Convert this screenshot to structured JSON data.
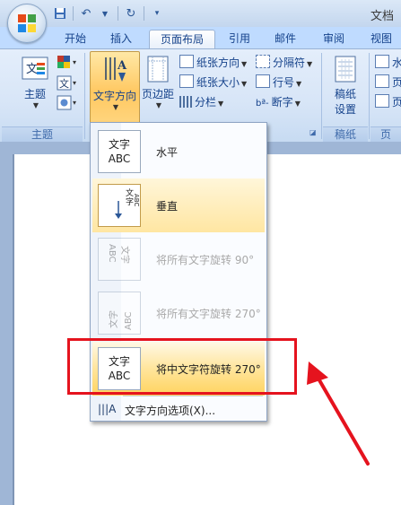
{
  "titlebar": {
    "app_title": "文档",
    "qat_icons": [
      "save-icon",
      "undo-icon",
      "redo-icon",
      "customize-icon"
    ]
  },
  "tabs": [
    "开始",
    "插入",
    "页面布局",
    "引用",
    "邮件",
    "审阅",
    "视图"
  ],
  "active_tab": "页面布局",
  "ribbon": {
    "theme_group": {
      "themes_label": "主题",
      "group_label": "主题"
    },
    "page_setup": {
      "text_direction_label": "文字方向",
      "margins_label": "页边距",
      "orientation_label": "纸张方向",
      "size_label": "纸张大小",
      "columns_label": "分栏",
      "breaks_label": "分隔符",
      "line_numbers_label": "行号",
      "hyphenation_label": "断字"
    },
    "draft_group": {
      "draft_label_line1": "稿纸",
      "draft_label_line2": "设置",
      "group_label": "稿纸"
    },
    "right_group": {
      "item1": "水",
      "item2": "页",
      "item3": "页",
      "group_label": "页"
    }
  },
  "menu": {
    "items": [
      {
        "label": "水平",
        "icon_text_top": "文字",
        "icon_text_bottom": "ABC",
        "state": "normal"
      },
      {
        "label": "垂直",
        "state": "selected"
      },
      {
        "label": "将所有文字旋转 90°",
        "state": "disabled"
      },
      {
        "label": "将所有文字旋转 270°",
        "state": "disabled"
      },
      {
        "label": "将中文字符旋转 270°",
        "icon_text_top": "文字",
        "icon_text_bottom": "ABC",
        "state": "hover"
      }
    ],
    "options_label": "文字方向选项(X)..."
  },
  "colors": {
    "highlight": "#e5131e",
    "hover_top": "#fff9e6",
    "hover_bottom": "#ffd35f"
  }
}
